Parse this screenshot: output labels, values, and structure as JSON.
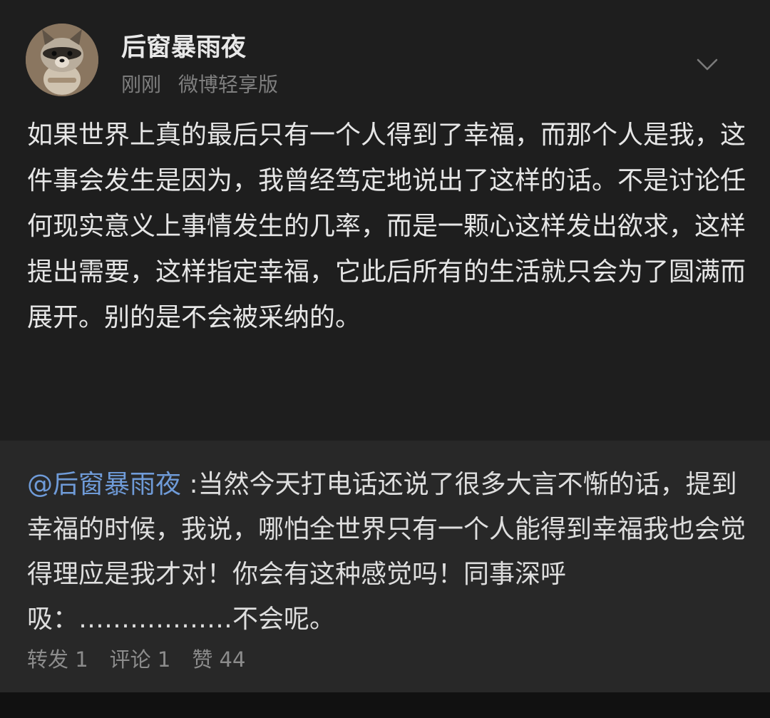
{
  "post": {
    "author": "后窗暴雨夜",
    "time": "刚刚",
    "source": "微博轻享版",
    "avatar_icon": "raccoon-avatar",
    "menu_icon": "chevron-down-icon",
    "text": "如果世界上真的最后只有一个人得到了幸福，而那个人是我，这件事会发生是因为，我曾经笃定地说出了这样的话。不是讨论任何现实意义上事情发生的几率，而是一颗心这样发出欲求，这样提出需要，这样指定幸福，它此后所有的生活就只会为了圆满而展开。别的是不会被采纳的。"
  },
  "repost": {
    "mention": "@后窗暴雨夜",
    "text": " :当然今天打电话还说了很多大言不惭的话，提到幸福的时候，我说，哪怕全世界只有一个人能得到幸福我也会觉得理应是我才对！你会有这种感觉吗！同事深呼吸：………………不会呢。",
    "forward": "转发 1",
    "comment": "评论 1",
    "like": "赞 44"
  },
  "colors": {
    "background": "#111111",
    "post_background": "#1e1e1e",
    "repost_background": "#282828",
    "mention": "#6f9bd8",
    "text": "#e6e6e6",
    "secondary_text": "#7f7f7f"
  }
}
